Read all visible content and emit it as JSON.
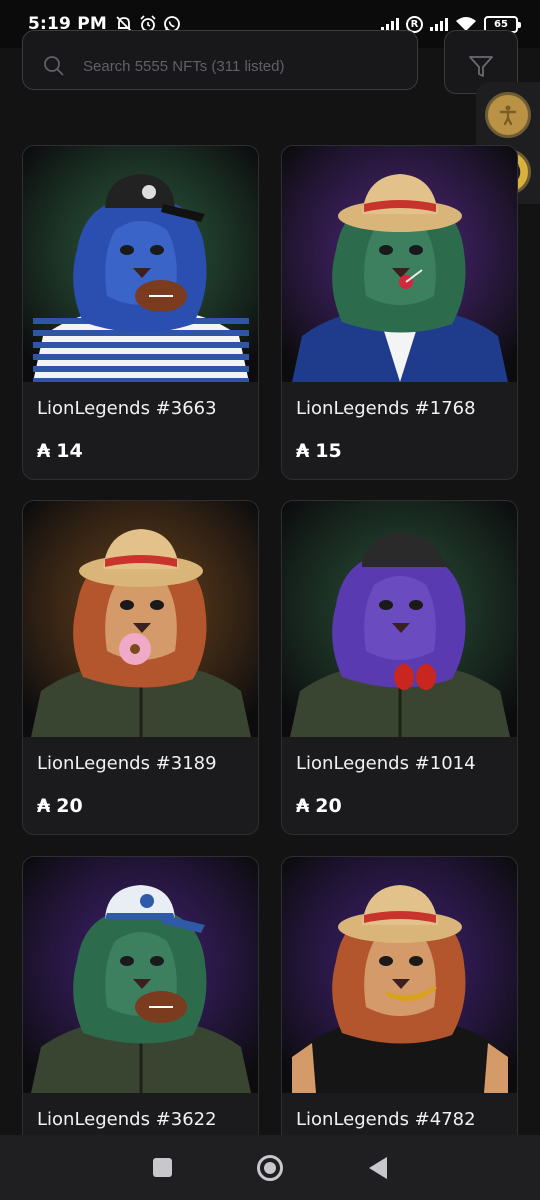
{
  "status_bar": {
    "time": "5:19 PM",
    "battery": "65"
  },
  "search": {
    "placeholder": "Search 5555 NFTs (311 listed)"
  },
  "currency_symbol": "₳",
  "cards": [
    {
      "title": "LionLegends #3663",
      "price": "14",
      "bg": "#2f6a45",
      "mane": "#2a4fb0",
      "skin": "#3b64c8",
      "hat": "cap-black",
      "outfit": "stripes",
      "prop": "football"
    },
    {
      "title": "LionLegends #1768",
      "price": "15",
      "bg": "#5a2a93",
      "mane": "#2d6b4d",
      "skin": "#3c8060",
      "hat": "straw",
      "outfit": "suit",
      "prop": "lollipop"
    },
    {
      "title": "LionLegends #3189",
      "price": "20",
      "bg": "#7a4a1c",
      "mane": "#b3562d",
      "skin": "#d49a6a",
      "hat": "straw",
      "outfit": "jacket",
      "prop": "donut"
    },
    {
      "title": "LionLegends #1014",
      "price": "20",
      "bg": "#2b5a3c",
      "mane": "#5a3ab0",
      "skin": "#6a4cc0",
      "hat": "flatcap",
      "outfit": "jacket",
      "prop": "gloves"
    },
    {
      "title": "LionLegends #3622",
      "price": "",
      "bg": "#4a2288",
      "mane": "#2d6b4d",
      "skin": "#3c8060",
      "hat": "cap-blue",
      "outfit": "jacket",
      "prop": "football"
    },
    {
      "title": "LionLegends #4782",
      "price": "",
      "bg": "#4a2288",
      "mane": "#b3562d",
      "skin": "#d49a6a",
      "hat": "straw",
      "outfit": "tee",
      "prop": "banana"
    }
  ]
}
